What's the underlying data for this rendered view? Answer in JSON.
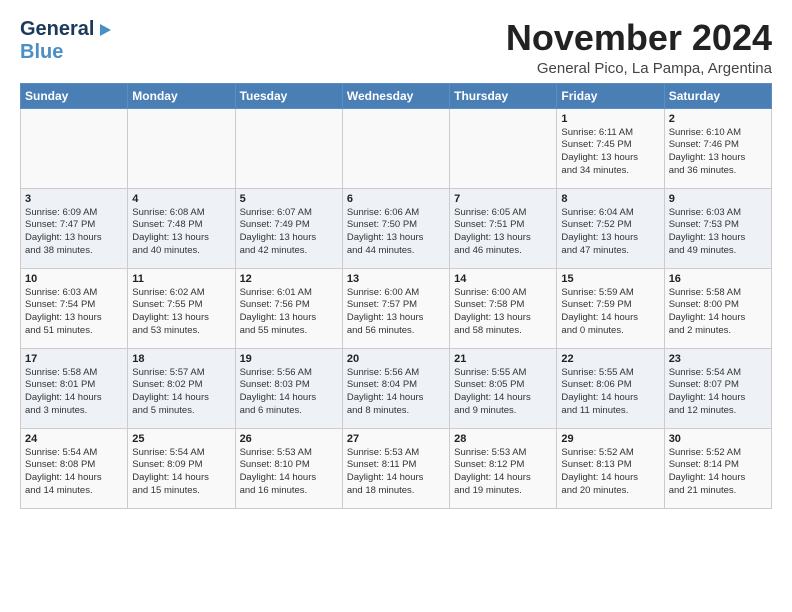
{
  "logo": {
    "general": "General",
    "blue": "Blue"
  },
  "title": "November 2024",
  "subtitle": "General Pico, La Pampa, Argentina",
  "days_of_week": [
    "Sunday",
    "Monday",
    "Tuesday",
    "Wednesday",
    "Thursday",
    "Friday",
    "Saturday"
  ],
  "weeks": [
    [
      {
        "day": "",
        "text": ""
      },
      {
        "day": "",
        "text": ""
      },
      {
        "day": "",
        "text": ""
      },
      {
        "day": "",
        "text": ""
      },
      {
        "day": "",
        "text": ""
      },
      {
        "day": "1",
        "text": "Sunrise: 6:11 AM\nSunset: 7:45 PM\nDaylight: 13 hours\nand 34 minutes."
      },
      {
        "day": "2",
        "text": "Sunrise: 6:10 AM\nSunset: 7:46 PM\nDaylight: 13 hours\nand 36 minutes."
      }
    ],
    [
      {
        "day": "3",
        "text": "Sunrise: 6:09 AM\nSunset: 7:47 PM\nDaylight: 13 hours\nand 38 minutes."
      },
      {
        "day": "4",
        "text": "Sunrise: 6:08 AM\nSunset: 7:48 PM\nDaylight: 13 hours\nand 40 minutes."
      },
      {
        "day": "5",
        "text": "Sunrise: 6:07 AM\nSunset: 7:49 PM\nDaylight: 13 hours\nand 42 minutes."
      },
      {
        "day": "6",
        "text": "Sunrise: 6:06 AM\nSunset: 7:50 PM\nDaylight: 13 hours\nand 44 minutes."
      },
      {
        "day": "7",
        "text": "Sunrise: 6:05 AM\nSunset: 7:51 PM\nDaylight: 13 hours\nand 46 minutes."
      },
      {
        "day": "8",
        "text": "Sunrise: 6:04 AM\nSunset: 7:52 PM\nDaylight: 13 hours\nand 47 minutes."
      },
      {
        "day": "9",
        "text": "Sunrise: 6:03 AM\nSunset: 7:53 PM\nDaylight: 13 hours\nand 49 minutes."
      }
    ],
    [
      {
        "day": "10",
        "text": "Sunrise: 6:03 AM\nSunset: 7:54 PM\nDaylight: 13 hours\nand 51 minutes."
      },
      {
        "day": "11",
        "text": "Sunrise: 6:02 AM\nSunset: 7:55 PM\nDaylight: 13 hours\nand 53 minutes."
      },
      {
        "day": "12",
        "text": "Sunrise: 6:01 AM\nSunset: 7:56 PM\nDaylight: 13 hours\nand 55 minutes."
      },
      {
        "day": "13",
        "text": "Sunrise: 6:00 AM\nSunset: 7:57 PM\nDaylight: 13 hours\nand 56 minutes."
      },
      {
        "day": "14",
        "text": "Sunrise: 6:00 AM\nSunset: 7:58 PM\nDaylight: 13 hours\nand 58 minutes."
      },
      {
        "day": "15",
        "text": "Sunrise: 5:59 AM\nSunset: 7:59 PM\nDaylight: 14 hours\nand 0 minutes."
      },
      {
        "day": "16",
        "text": "Sunrise: 5:58 AM\nSunset: 8:00 PM\nDaylight: 14 hours\nand 2 minutes."
      }
    ],
    [
      {
        "day": "17",
        "text": "Sunrise: 5:58 AM\nSunset: 8:01 PM\nDaylight: 14 hours\nand 3 minutes."
      },
      {
        "day": "18",
        "text": "Sunrise: 5:57 AM\nSunset: 8:02 PM\nDaylight: 14 hours\nand 5 minutes."
      },
      {
        "day": "19",
        "text": "Sunrise: 5:56 AM\nSunset: 8:03 PM\nDaylight: 14 hours\nand 6 minutes."
      },
      {
        "day": "20",
        "text": "Sunrise: 5:56 AM\nSunset: 8:04 PM\nDaylight: 14 hours\nand 8 minutes."
      },
      {
        "day": "21",
        "text": "Sunrise: 5:55 AM\nSunset: 8:05 PM\nDaylight: 14 hours\nand 9 minutes."
      },
      {
        "day": "22",
        "text": "Sunrise: 5:55 AM\nSunset: 8:06 PM\nDaylight: 14 hours\nand 11 minutes."
      },
      {
        "day": "23",
        "text": "Sunrise: 5:54 AM\nSunset: 8:07 PM\nDaylight: 14 hours\nand 12 minutes."
      }
    ],
    [
      {
        "day": "24",
        "text": "Sunrise: 5:54 AM\nSunset: 8:08 PM\nDaylight: 14 hours\nand 14 minutes."
      },
      {
        "day": "25",
        "text": "Sunrise: 5:54 AM\nSunset: 8:09 PM\nDaylight: 14 hours\nand 15 minutes."
      },
      {
        "day": "26",
        "text": "Sunrise: 5:53 AM\nSunset: 8:10 PM\nDaylight: 14 hours\nand 16 minutes."
      },
      {
        "day": "27",
        "text": "Sunrise: 5:53 AM\nSunset: 8:11 PM\nDaylight: 14 hours\nand 18 minutes."
      },
      {
        "day": "28",
        "text": "Sunrise: 5:53 AM\nSunset: 8:12 PM\nDaylight: 14 hours\nand 19 minutes."
      },
      {
        "day": "29",
        "text": "Sunrise: 5:52 AM\nSunset: 8:13 PM\nDaylight: 14 hours\nand 20 minutes."
      },
      {
        "day": "30",
        "text": "Sunrise: 5:52 AM\nSunset: 8:14 PM\nDaylight: 14 hours\nand 21 minutes."
      }
    ]
  ]
}
